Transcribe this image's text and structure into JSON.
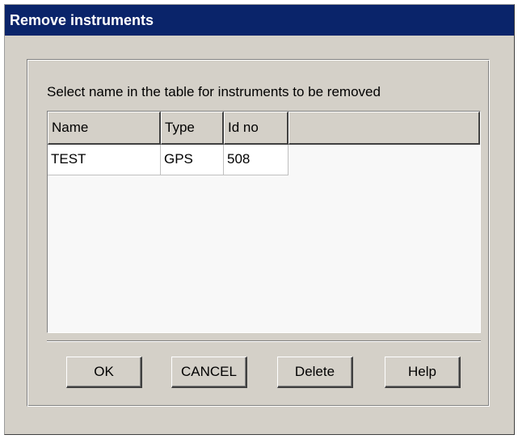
{
  "window": {
    "title": "Remove instruments"
  },
  "dialog": {
    "instructions": "Select name in the table for instruments to be removed"
  },
  "table": {
    "headers": [
      "Name",
      "Type",
      "Id  no"
    ],
    "rows": [
      [
        "TEST",
        "GPS",
        "508"
      ]
    ]
  },
  "buttons": {
    "ok": "OK",
    "cancel": "CANCEL",
    "delete": "Delete",
    "help": "Help"
  },
  "colors": {
    "titlebar": "#0a246a",
    "face": "#d4d0c8"
  }
}
